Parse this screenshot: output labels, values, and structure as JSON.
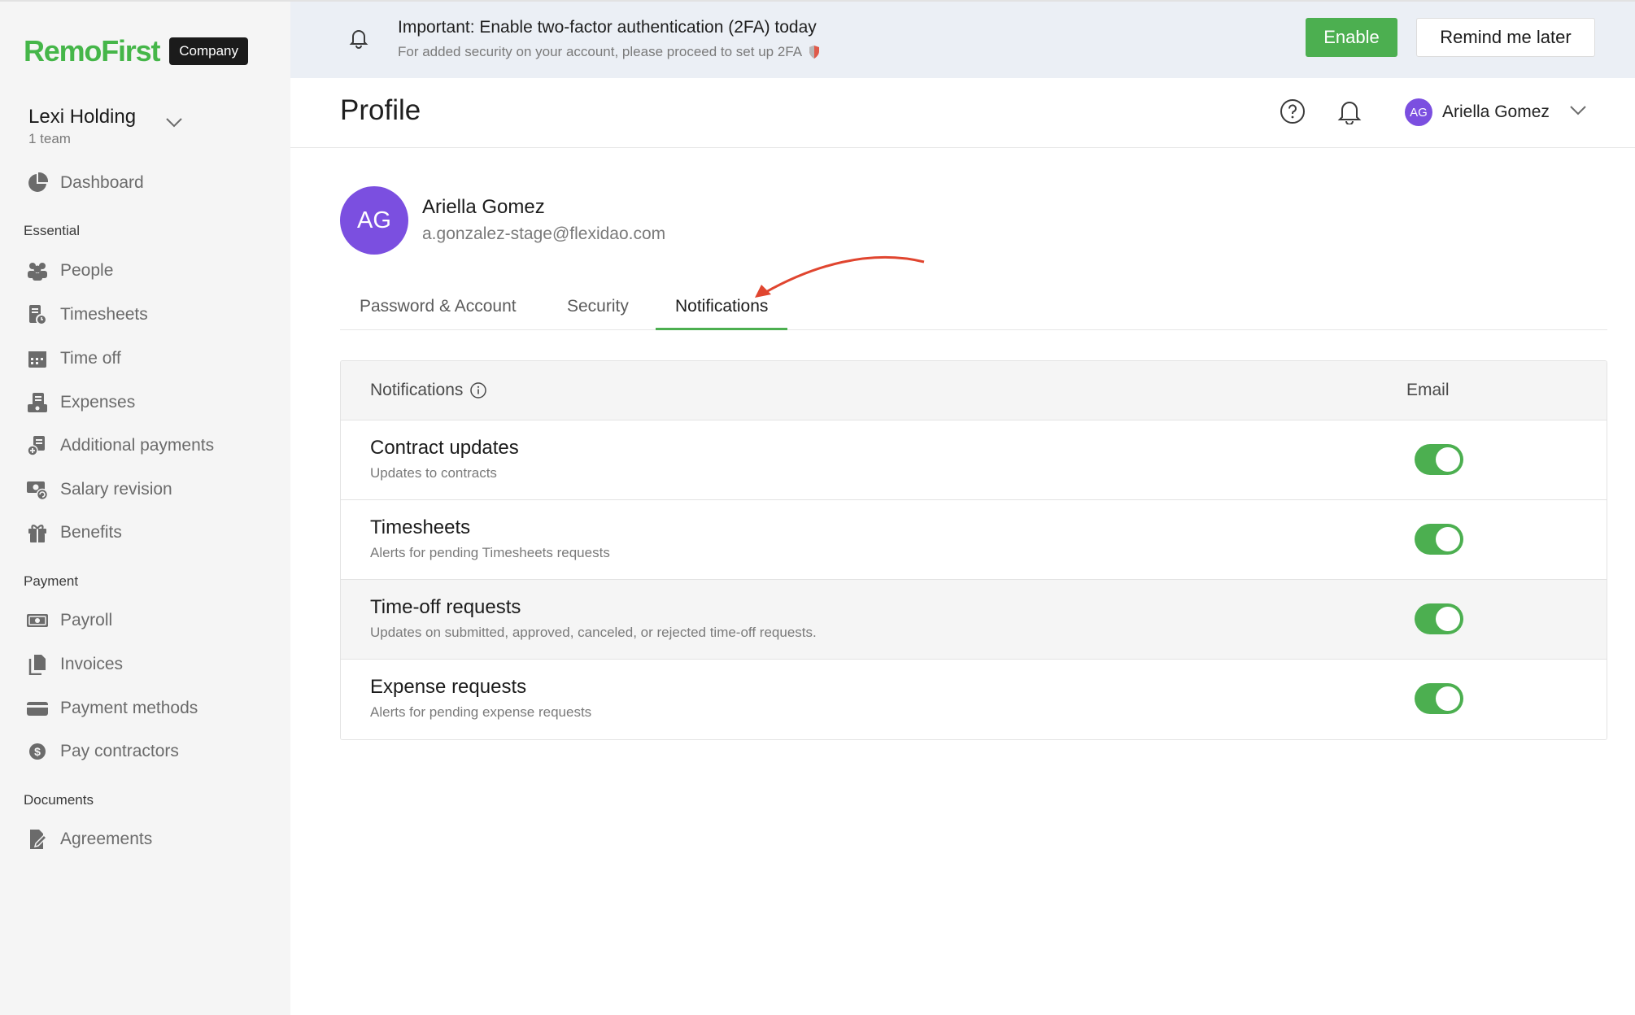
{
  "brand": {
    "logo": "RemoFirst",
    "badge": "Company",
    "accent": "#4caf50"
  },
  "org": {
    "name": "Lexi Holding",
    "sub": "1 team"
  },
  "nav": {
    "dashboard": "Dashboard",
    "essential_label": "Essential",
    "people": "People",
    "timesheets": "Timesheets",
    "time_off": "Time off",
    "expenses": "Expenses",
    "additional_payments": "Additional payments",
    "salary_revision": "Salary revision",
    "benefits": "Benefits",
    "payment_label": "Payment",
    "payroll": "Payroll",
    "invoices": "Invoices",
    "payment_methods": "Payment methods",
    "pay_contractors": "Pay contractors",
    "documents_label": "Documents",
    "agreements": "Agreements"
  },
  "banner": {
    "title": "Important: Enable two-factor authentication (2FA) today",
    "subtitle": "For added security on your account, please proceed to set up 2FA",
    "enable_label": "Enable",
    "remind_label": "Remind me later"
  },
  "header": {
    "title": "Profile",
    "user_initials": "AG",
    "user_name": "Ariella Gomez"
  },
  "profile": {
    "initials": "AG",
    "name": "Ariella Gomez",
    "email": "a.gonzalez-stage@flexidao.com"
  },
  "tabs": [
    {
      "label": "Password & Account",
      "active": false
    },
    {
      "label": "Security",
      "active": false
    },
    {
      "label": "Notifications",
      "active": true
    }
  ],
  "notifications": {
    "header_label": "Notifications",
    "email_label": "Email",
    "rows": [
      {
        "title": "Contract updates",
        "desc": "Updates to contracts",
        "email": true
      },
      {
        "title": "Timesheets",
        "desc": "Alerts for pending Timesheets requests",
        "email": true
      },
      {
        "title": "Time-off requests",
        "desc": "Updates on submitted, approved, canceled, or rejected time-off requests.",
        "email": true
      },
      {
        "title": "Expense requests",
        "desc": "Alerts for pending expense requests",
        "email": true
      }
    ]
  }
}
